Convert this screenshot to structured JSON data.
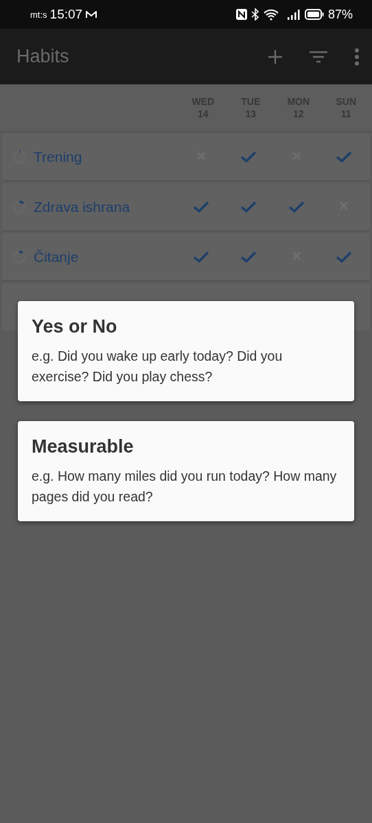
{
  "status_bar": {
    "carrier": "mt:s",
    "time": "15:07",
    "battery": "87%"
  },
  "app_bar": {
    "title": "Habits"
  },
  "days": [
    {
      "weekday": "WED",
      "date": "14"
    },
    {
      "weekday": "TUE",
      "date": "13"
    },
    {
      "weekday": "MON",
      "date": "12"
    },
    {
      "weekday": "SUN",
      "date": "11"
    }
  ],
  "habits": [
    {
      "name": "Trening",
      "checks": [
        false,
        true,
        false,
        true
      ]
    },
    {
      "name": "Zdrava ishrana",
      "checks": [
        true,
        true,
        true,
        false
      ]
    },
    {
      "name": "Čitanje",
      "checks": [
        true,
        true,
        false,
        true
      ]
    }
  ],
  "dialog": {
    "options": [
      {
        "title": "Yes or No",
        "description": "e.g. Did you wake up early today? Did you exercise? Did you play chess?"
      },
      {
        "title": "Measurable",
        "description": "e.g. How many miles did you run today? How many pages did you read?"
      }
    ]
  }
}
